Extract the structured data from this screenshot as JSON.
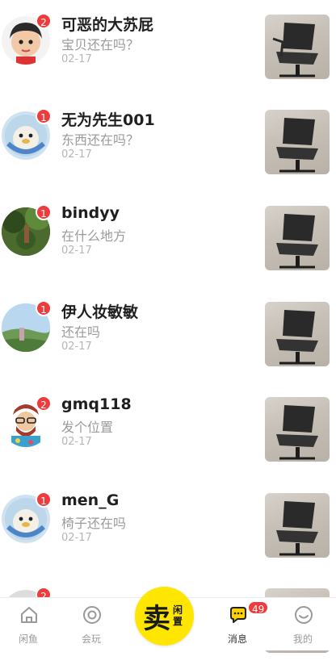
{
  "conversations": [
    {
      "name": "可恶的大苏屁",
      "message": "宝贝还在吗？",
      "date": "02-17",
      "unread": "2"
    },
    {
      "name": "无为先生001",
      "message": "东西还在吗？",
      "date": "02-17",
      "unread": "1"
    },
    {
      "name": "bindyy",
      "message": "在什么地方",
      "date": "02-17",
      "unread": "1"
    },
    {
      "name": "伊人妆敏敏",
      "message": "还在吗",
      "date": "02-17",
      "unread": "1"
    },
    {
      "name": "gmq118",
      "message": "发个位置",
      "date": "02-17",
      "unread": "2"
    },
    {
      "name": "men_G",
      "message": "椅子还在吗",
      "date": "02-17",
      "unread": "1"
    },
    {
      "name": "",
      "message": "",
      "date": "",
      "unread": "2"
    }
  ],
  "tabbar": {
    "tabs": [
      {
        "label": "闲鱼",
        "icon": "home-icon"
      },
      {
        "label": "会玩",
        "icon": "play-circle-icon"
      },
      {
        "label": "消息",
        "icon": "message-icon",
        "badge": "49"
      },
      {
        "label": "我的",
        "icon": "profile-icon"
      }
    ],
    "sell_button": {
      "big": "卖",
      "small": "闲置"
    }
  },
  "colors": {
    "accent": "#ffe600",
    "badge": "#ee3b3b"
  }
}
